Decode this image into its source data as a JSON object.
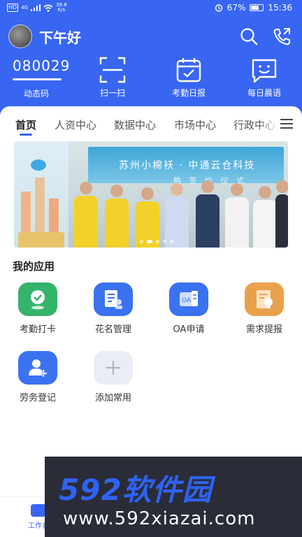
{
  "status_bar": {
    "network_badge": "HD",
    "network": "4G",
    "speed_value": "39.8",
    "speed_unit": "K/s",
    "alarm_icon": "alarm-icon",
    "battery": "67%",
    "time": "15:36"
  },
  "header": {
    "greeting": "下午好",
    "dynamic_code": "080029",
    "dynamic_code_progress": 1.0,
    "dynamic_code_label": "动态码",
    "quick_actions": [
      {
        "label": "扫一扫",
        "icon": "scan-icon"
      },
      {
        "label": "考勤日报",
        "icon": "calendar-check-icon"
      },
      {
        "label": "每日晨语",
        "icon": "smile-chat-icon"
      }
    ]
  },
  "tabs": [
    "首页",
    "人资中心",
    "数据中心",
    "市场中心",
    "行政中心"
  ],
  "banner": {
    "text": "苏州小棉袄 · 中通云仓科技",
    "subtitle": "略 签 约 仪 式",
    "slide_count": 5,
    "active_slide": 1
  },
  "apps_section": {
    "title": "我的应用",
    "apps": [
      {
        "label": "考勤打卡",
        "color": "#34b36b"
      },
      {
        "label": "花名管理",
        "color": "#3a72f0"
      },
      {
        "label": "OA申请",
        "color": "#3a72f0"
      },
      {
        "label": "需求提报",
        "color": "#e8a14a"
      },
      {
        "label": "劳务登记",
        "color": "#3a72f0"
      },
      {
        "label": "添加常用",
        "color": "#e9eef5"
      }
    ]
  },
  "bottom_nav": {
    "item": "工作台"
  },
  "watermark": {
    "brand": "592软件园",
    "url": "www.592xiazai.com"
  },
  "colors": {
    "primary": "#3866f2",
    "green": "#34b36b",
    "orange": "#e8a14a"
  }
}
